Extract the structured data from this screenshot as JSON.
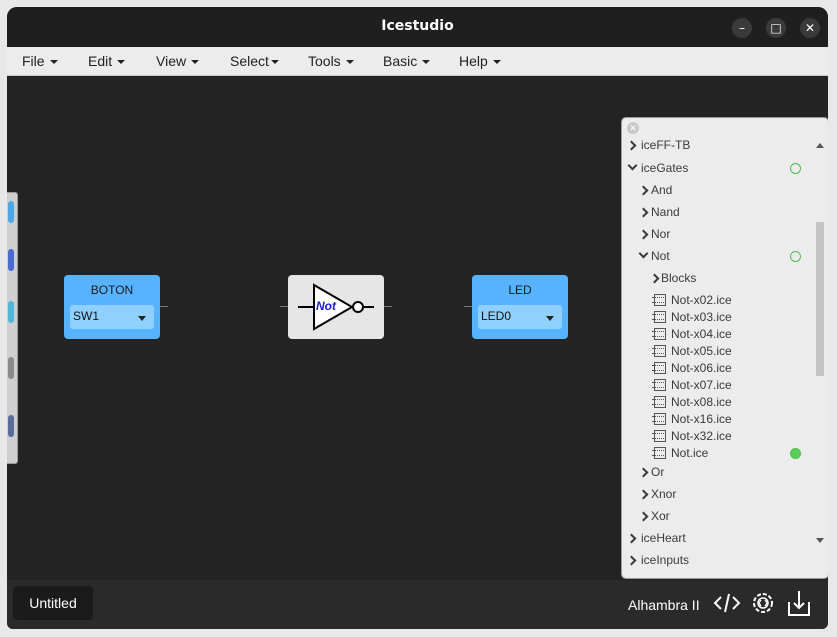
{
  "window": {
    "title": "Icestudio"
  },
  "menu": [
    {
      "label": "File"
    },
    {
      "label": "Edit"
    },
    {
      "label": "View"
    },
    {
      "label": "Select"
    },
    {
      "label": "Tools"
    },
    {
      "label": "Basic"
    },
    {
      "label": "Help"
    }
  ],
  "blocks": {
    "input": {
      "label": "BOTON",
      "value": "SW1"
    },
    "gate": {
      "label": "Not"
    },
    "output": {
      "label": "LED",
      "value": "LED0"
    }
  },
  "tree": {
    "items": [
      {
        "label": "iceFF-TB",
        "expanded": false,
        "kind": "folder",
        "level": 0
      },
      {
        "label": "iceGates",
        "expanded": true,
        "kind": "folder",
        "level": 0,
        "status": "empty-circle"
      },
      {
        "label": "And",
        "expanded": false,
        "kind": "folder",
        "level": 1
      },
      {
        "label": "Nand",
        "expanded": false,
        "kind": "folder",
        "level": 1
      },
      {
        "label": "Nor",
        "expanded": false,
        "kind": "folder",
        "level": 1
      },
      {
        "label": "Not",
        "expanded": true,
        "kind": "folder",
        "level": 1,
        "status": "empty-circle"
      },
      {
        "label": "Blocks",
        "expanded": false,
        "kind": "folder",
        "level": 2
      },
      {
        "label": "Not-x02.ice",
        "kind": "file",
        "level": 2
      },
      {
        "label": "Not-x03.ice",
        "kind": "file",
        "level": 2
      },
      {
        "label": "Not-x04.ice",
        "kind": "file",
        "level": 2
      },
      {
        "label": "Not-x05.ice",
        "kind": "file",
        "level": 2
      },
      {
        "label": "Not-x06.ice",
        "kind": "file",
        "level": 2
      },
      {
        "label": "Not-x07.ice",
        "kind": "file",
        "level": 2
      },
      {
        "label": "Not-x08.ice",
        "kind": "file",
        "level": 2
      },
      {
        "label": "Not-x16.ice",
        "kind": "file",
        "level": 2
      },
      {
        "label": "Not-x32.ice",
        "kind": "file",
        "level": 2
      },
      {
        "label": "Not.ice",
        "kind": "file",
        "level": 2,
        "status": "filled-circle"
      },
      {
        "label": "Or",
        "expanded": false,
        "kind": "folder",
        "level": 1
      },
      {
        "label": "Xnor",
        "expanded": false,
        "kind": "folder",
        "level": 1
      },
      {
        "label": "Xor",
        "expanded": false,
        "kind": "folder",
        "level": 1
      },
      {
        "label": "iceHeart",
        "expanded": false,
        "kind": "folder",
        "level": 0
      },
      {
        "label": "iceInputs",
        "expanded": false,
        "kind": "folder",
        "level": 0
      }
    ]
  },
  "status": {
    "tab_label": "Untitled",
    "board": "Alhambra II",
    "icons": [
      "code-icon",
      "settings-gear-icon",
      "download-icon"
    ]
  },
  "colors": {
    "accent_blue": "#57b2ff",
    "status_green": "#5bcf5b",
    "canvas": "#232323"
  }
}
